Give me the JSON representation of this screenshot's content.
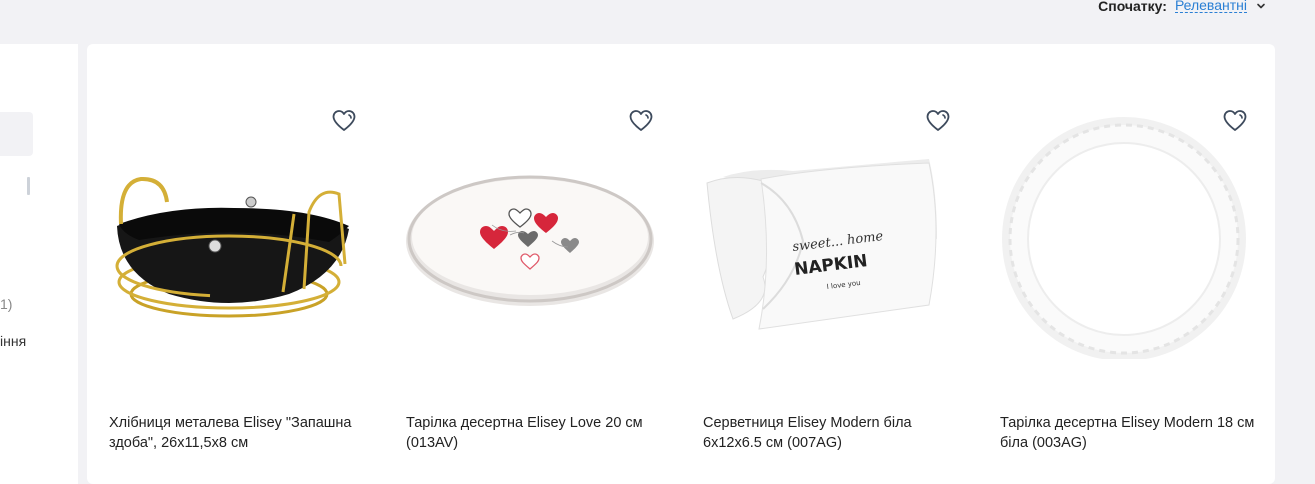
{
  "sort": {
    "label": "Спочатку:",
    "value": "Релевантні"
  },
  "sidebar": {
    "fragment_1": "1)",
    "fragment_2": "іння"
  },
  "products": [
    {
      "title": "Хлібниця металева Elisey \"Запашна здоба\", 26х11,5х8 см",
      "image": "bread-basket"
    },
    {
      "title": "Тарілка десертна Elisey Love 20 см (013AV)",
      "image": "love-plate"
    },
    {
      "title": "Серветниця Elisey Modern біла 6х12х6.5 см (007AG)",
      "image": "napkin-holder"
    },
    {
      "title": "Тарілка десертна Elisey Modern 18 см біла (003AG)",
      "image": "white-plate"
    }
  ],
  "napkin_print": {
    "line1": "sweet... home",
    "line2": "NAPKIN",
    "line3": "I love you"
  },
  "colors": {
    "accent": "#2a7fd4",
    "background": "#f2f2f5",
    "icon": "#3d4a5c"
  }
}
